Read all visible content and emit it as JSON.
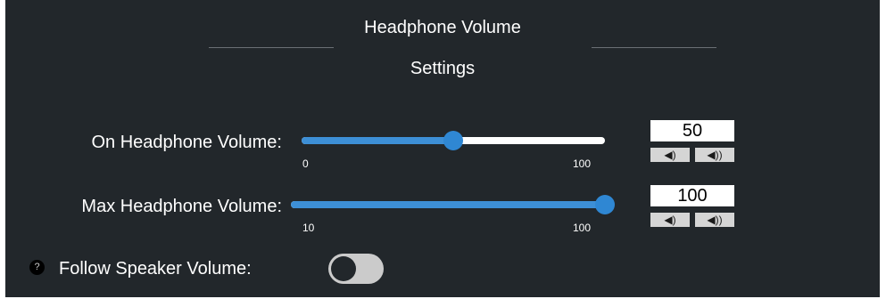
{
  "header": {
    "title_line1": "Headphone Volume",
    "title_line2": "Settings"
  },
  "on_volume": {
    "label": "On Headphone Volume:",
    "min_label": "0",
    "max_label": "100",
    "value": "50",
    "level_fraction": 0.5
  },
  "max_volume": {
    "label": "Max Headphone Volume:",
    "min_label": "10",
    "max_label": "100",
    "value": "100",
    "level_fraction": 1.0
  },
  "follow_speaker": {
    "label": "Follow Speaker Volume:",
    "help_glyph": "?",
    "enabled": false
  },
  "icons": {
    "volume_down": "volume-down-icon",
    "volume_up": "volume-up-icon"
  },
  "colors": {
    "panel_background": "#22272b",
    "accent": "#3d8fd6",
    "toggle_off": "#cbcbcb"
  }
}
